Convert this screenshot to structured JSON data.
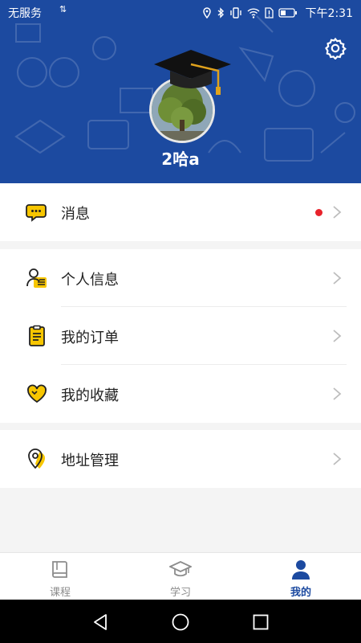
{
  "status_bar": {
    "carrier": "无服务",
    "data_arrows": "⇅",
    "time": "下午2:31"
  },
  "profile": {
    "username": "2哈a"
  },
  "menu": {
    "message": {
      "label": "消息",
      "has_unread": true
    },
    "personal_info": {
      "label": "个人信息"
    },
    "orders": {
      "label": "我的订单"
    },
    "favorites": {
      "label": "我的收藏"
    },
    "address": {
      "label": "地址管理"
    }
  },
  "tabs": [
    {
      "label": "课程",
      "icon": "book-icon",
      "active": false
    },
    {
      "label": "学习",
      "icon": "graduation-cap-icon",
      "active": false
    },
    {
      "label": "我的",
      "icon": "user-icon",
      "active": true
    }
  ],
  "colors": {
    "brand_blue": "#1c4aa0",
    "accent_yellow": "#f7c600",
    "unread_red": "#e8232b"
  }
}
